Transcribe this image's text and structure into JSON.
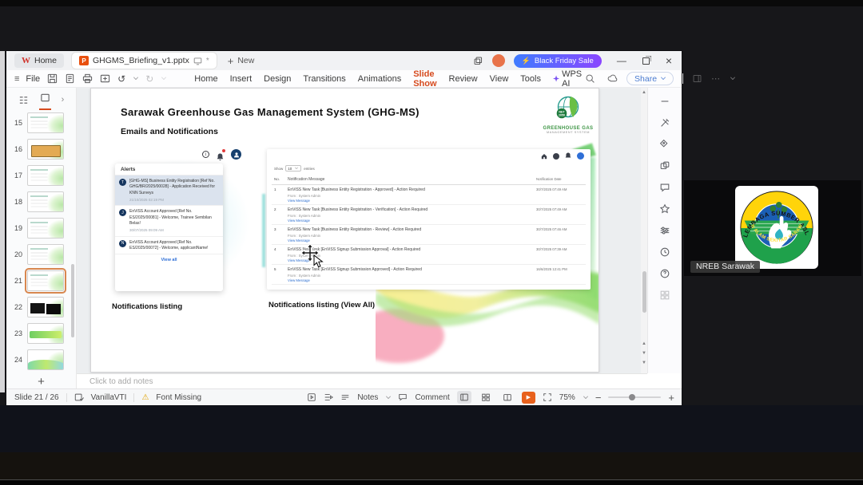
{
  "chrome": {
    "tab_home": "Home",
    "doc_title": "GHGMS_Briefing_v1.pptx",
    "tab_new": "New",
    "promo": "Black Friday Sale",
    "file": "File",
    "menus": [
      "Home",
      "Insert",
      "Design",
      "Transitions",
      "Animations",
      "Slide Show",
      "Review",
      "View",
      "Tools",
      "WPS AI"
    ],
    "active_menu": "Slide Show",
    "share": "Share",
    "sidebar_icons": [
      "collapse",
      "tools",
      "tag",
      "shapes",
      "comment",
      "star",
      "settings",
      "history",
      "help",
      "apps"
    ]
  },
  "slide": {
    "title": "Sarawak Greenhouse Gas Management System (GHG-MS)",
    "subtitle": "Emails and Notifications",
    "logo": {
      "badge_line1": "NET",
      "badge_line2": "2050",
      "name_line1": "GREENHOUSE GAS",
      "name_line2": "MANAGEMENT SYSTEM"
    },
    "alerts": {
      "header": "Alerts",
      "view_all": "View all",
      "items": [
        {
          "initial": "T",
          "text": "[GHG-MS] Business Entity Registration [Ref No. GHG/BR/2025/00028] - Application Received for KNN Surveys",
          "date": "21/10/2025 02:19 PM",
          "unread": true
        },
        {
          "initial": "J",
          "text": "EnViSS Account Approved [Ref No. ES/2025/00081] - Welcome, Trainee Sembilan Belas!",
          "date": "30/07/2025 09:09 AM",
          "unread": false
        },
        {
          "initial": "N",
          "text": "EnViSS Account Approved [Ref No. ES/2025/00072] - Welcome, applicantName!",
          "date": "",
          "unread": false
        }
      ]
    },
    "listing": {
      "show": "Show",
      "page_size": "10",
      "entries": "entries",
      "headers": [
        "No.",
        "Notification Message",
        "Notification Date"
      ],
      "rows": [
        {
          "no": "1",
          "message": "EnViSS New Task [Business Entity Registration - Approved] - Action Required",
          "from": "From : System Admin",
          "link": "View Message",
          "date": "30/7/2025 07:49 AM"
        },
        {
          "no": "2",
          "message": "EnViSS New Task [Business Entity Registration - Verification] - Action Required",
          "from": "From : System Admin",
          "link": "View Message",
          "date": "30/7/2025 07:49 AM"
        },
        {
          "no": "3",
          "message": "EnViSS New Task [Business Entity Registration - Review] - Action Required",
          "from": "From : System Admin",
          "link": "View Message",
          "date": "30/7/2025 07:46 AM"
        },
        {
          "no": "4",
          "message": "EnViSS New Task [EnViSS Signup Submission Approval] - Action Required",
          "from": "From : System Admin",
          "link": "View Message",
          "date": "30/7/2025 07:39 AM"
        },
        {
          "no": "5",
          "message": "EnViSS New Task [EnViSS Signup Submission Approved] - Action Required",
          "from": "From : System Admin",
          "link": "View Message",
          "date": "16/6/2025 12:41 PM"
        }
      ]
    },
    "caption_left": "Notifications listing",
    "caption_right": "Notifications listing (View All)"
  },
  "thumbs": {
    "selected": 21,
    "items": [
      {
        "n": 15,
        "kind": "light"
      },
      {
        "n": 16,
        "kind": "orange"
      },
      {
        "n": 17,
        "kind": "light"
      },
      {
        "n": 18,
        "kind": "light"
      },
      {
        "n": 19,
        "kind": "light"
      },
      {
        "n": 20,
        "kind": "light"
      },
      {
        "n": 21,
        "kind": "light"
      },
      {
        "n": 22,
        "kind": "dark"
      },
      {
        "n": 23,
        "kind": "band"
      },
      {
        "n": 24,
        "kind": "wave"
      }
    ]
  },
  "notes_placeholder": "Click to add notes",
  "statusbar": {
    "slide_info": "Slide 21 / 26",
    "lang": "VanillaVTI",
    "warning": "Font Missing",
    "notes": "Notes",
    "comment": "Comment",
    "zoom": "75%"
  },
  "participant": {
    "name": "NREB Sarawak",
    "emblem_top": "LEMBAGA SUMBER ASLI",
    "emblem_bottom": "DAN ALAM SEKITAR SARAWAK"
  }
}
